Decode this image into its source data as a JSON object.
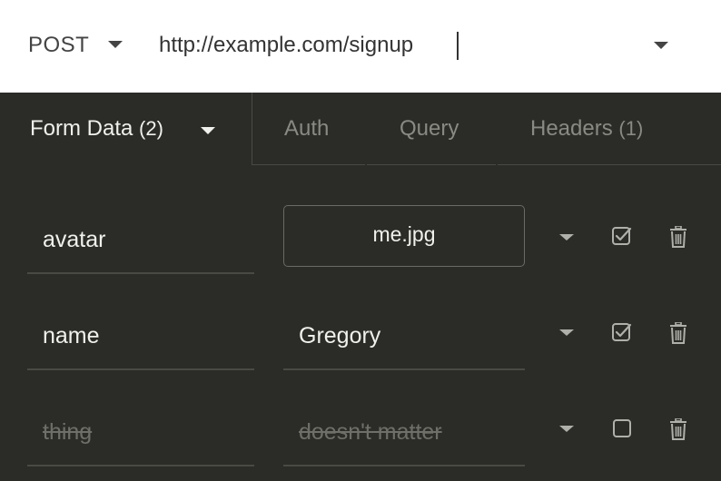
{
  "request": {
    "method": "POST",
    "url": "http://example.com/signup"
  },
  "tabs": [
    {
      "label": "Form Data",
      "count": "(2)",
      "active": true
    },
    {
      "label": "Auth",
      "count": "",
      "active": false
    },
    {
      "label": "Query",
      "count": "",
      "active": false
    },
    {
      "label": "Headers",
      "count": "(1)",
      "active": false
    }
  ],
  "params": [
    {
      "name": "avatar",
      "value": "me.jpg",
      "type": "file",
      "enabled": true
    },
    {
      "name": "name",
      "value": "Gregory",
      "type": "text",
      "enabled": true
    },
    {
      "name": "thing",
      "value": "doesn't matter",
      "type": "text",
      "enabled": false
    }
  ],
  "icons": {
    "method_dropdown": "chevron-down-icon",
    "url_dropdown": "chevron-down-icon",
    "row_dropdown": "chevron-down-icon",
    "enable_toggle": "checkbox-icon",
    "delete": "trash-icon"
  },
  "colors": {
    "background": "#2b2b27",
    "urlbar": "#ffffff",
    "text_active": "#f0f0ec",
    "text_muted": "#8a8a84",
    "text_disabled": "#6f6f69",
    "divider": "#4a4a45"
  }
}
